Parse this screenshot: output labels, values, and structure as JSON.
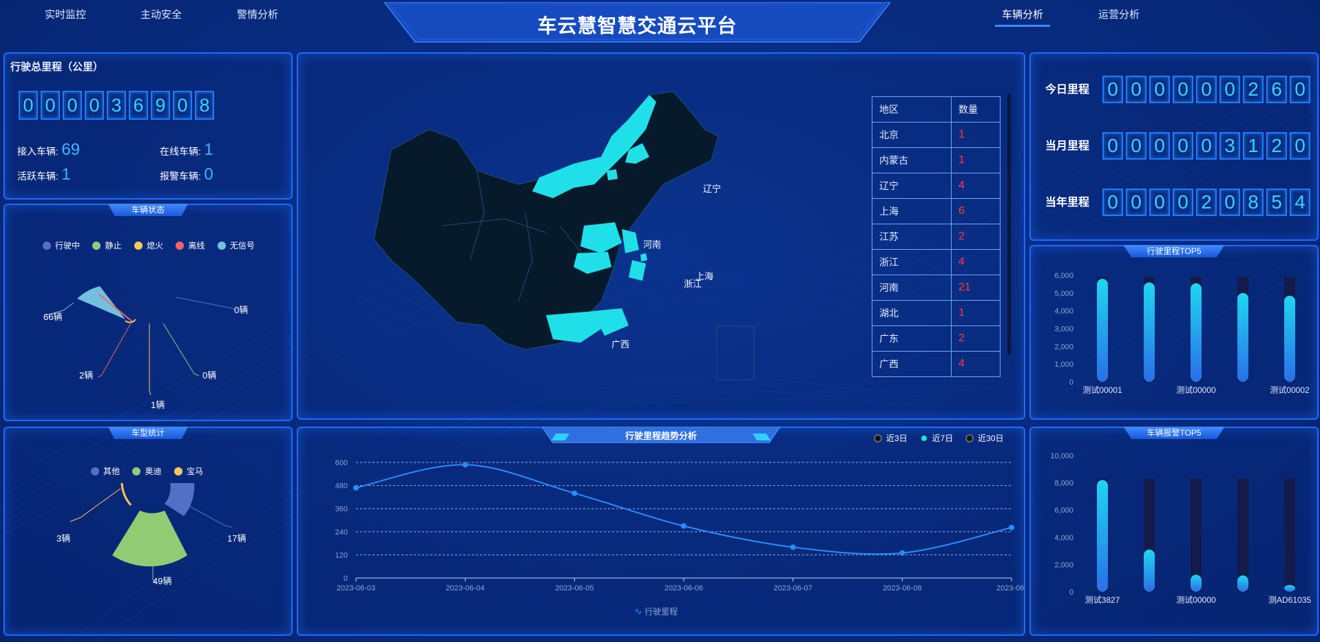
{
  "header": {
    "title": "车云慧智慧交通云平台",
    "nav_left": [
      "实时监控",
      "主动安全",
      "警情分析"
    ],
    "nav_right": [
      "车辆分析",
      "运营分析"
    ],
    "active_tab": "车辆分析"
  },
  "total_mileage": {
    "title": "行驶总里程（公里）",
    "digits": [
      "0",
      "0",
      "0",
      "0",
      "3",
      "6",
      "9",
      "0",
      "8"
    ],
    "stats": {
      "connected_label": "接入车辆:",
      "connected_value": "69",
      "online_label": "在线车辆:",
      "online_value": "1",
      "active_label": "活跃车辆:",
      "active_value": "1",
      "alarm_label": "报警车辆:",
      "alarm_value": "0"
    }
  },
  "vehicle_status": {
    "title": "车辆状态",
    "legend": [
      {
        "label": "行驶中",
        "color": "#5470c6"
      },
      {
        "label": "静止",
        "color": "#91cc75"
      },
      {
        "label": "熄火",
        "color": "#fac858"
      },
      {
        "label": "离线",
        "color": "#ee6666"
      },
      {
        "label": "无信号",
        "color": "#73c0de"
      }
    ],
    "labels": {
      "no_signal": "66辆",
      "offline": "2辆",
      "ignition_off": "1辆",
      "stationary": "0辆",
      "driving": "0辆"
    }
  },
  "vehicle_type": {
    "title": "车型统计",
    "legend": [
      {
        "label": "其他",
        "color": "#5470c6"
      },
      {
        "label": "奥迪",
        "color": "#91cc75"
      },
      {
        "label": "宝马",
        "color": "#fac858"
      }
    ],
    "labels": {
      "other": "17辆",
      "audi": "49辆",
      "bmw": "3辆"
    }
  },
  "map": {
    "table_headers": [
      "地区",
      "数量"
    ],
    "rows": [
      {
        "region": "北京",
        "count": "1"
      },
      {
        "region": "内蒙古",
        "count": "1"
      },
      {
        "region": "辽宁",
        "count": "4"
      },
      {
        "region": "上海",
        "count": "6"
      },
      {
        "region": "江苏",
        "count": "2"
      },
      {
        "region": "浙江",
        "count": "4"
      },
      {
        "region": "河南",
        "count": "21"
      },
      {
        "region": "湖北",
        "count": "1"
      },
      {
        "region": "广东",
        "count": "2"
      },
      {
        "region": "广西",
        "count": "4"
      }
    ],
    "map_labels": {
      "liaoning": "辽宁",
      "henan": "河南",
      "shanghai": "上海",
      "zhejiang": "浙江",
      "guangxi": "广西"
    }
  },
  "mileage_summary": {
    "today_label": "今日里程",
    "today_digits": [
      "0",
      "0",
      "0",
      "0",
      "0",
      "0",
      "2",
      "6",
      "0"
    ],
    "month_label": "当月里程",
    "month_digits": [
      "0",
      "0",
      "0",
      "0",
      "0",
      "3",
      "1",
      "2",
      "0"
    ],
    "year_label": "当年里程",
    "year_digits": [
      "0",
      "0",
      "0",
      "0",
      "2",
      "0",
      "8",
      "5",
      "4"
    ]
  },
  "trend": {
    "title": "行驶里程趋势分析",
    "range_options": [
      "近3日",
      "近7日",
      "近30日"
    ],
    "selected_range": "近7日",
    "legend_label": "行驶里程"
  },
  "colors": {
    "accent": "#1f6bff",
    "digit": "#38d2ff",
    "alert": "#ff3a3a",
    "map_highlight": "#1fe0e8",
    "map_base": "#071a2c"
  },
  "chart_data": [
    {
      "type": "bar",
      "title": "行驶里程TOP5",
      "categories": [
        "测试00001",
        "测试00000",
        "测试00002",
        "",
        ""
      ],
      "values": [
        5800,
        5600,
        5550,
        5000,
        4850
      ],
      "background": 5900,
      "ylim": [
        0,
        6000
      ],
      "yticks": [
        "6,000",
        "5,000",
        "4,000",
        "3,000",
        "2,000",
        "1,000",
        "0"
      ],
      "xtick_labels": [
        "测试00001",
        "测试00000",
        "测试00002"
      ]
    },
    {
      "type": "bar",
      "title": "车辆报警TOP5",
      "categories": [
        "测试3827",
        "",
        "测试00000",
        "",
        "测AD61035"
      ],
      "values": [
        8200,
        3100,
        1250,
        1200,
        500
      ],
      "background": 8300,
      "ylim": [
        0,
        10000
      ],
      "yticks": [
        "10,000",
        "8,000",
        "6,000",
        "4,000",
        "2,000",
        "0"
      ],
      "xtick_labels": [
        "测试3827",
        "测试00000",
        "测AD61035"
      ]
    },
    {
      "type": "line",
      "title": "行驶里程趋势分析",
      "x": [
        "2023-06-03",
        "2023-06-04",
        "2023-06-05",
        "2023-06-06",
        "2023-06-07",
        "2023-06-08",
        "2023-06-"
      ],
      "series": [
        {
          "name": "行驶里程",
          "values": [
            468,
            588,
            440,
            270,
            160,
            130,
            262
          ]
        }
      ],
      "ylim": [
        0,
        600
      ],
      "yticks": [
        "600",
        "480",
        "360",
        "240",
        "120",
        "0"
      ],
      "grid": true
    }
  ]
}
